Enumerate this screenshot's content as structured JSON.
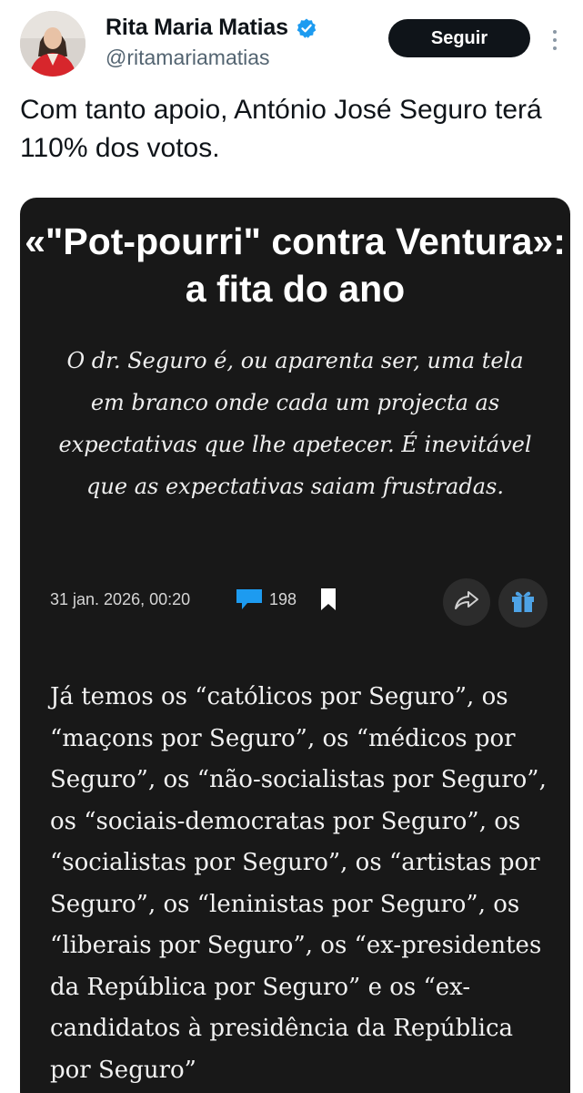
{
  "tweet": {
    "author": {
      "display_name": "Rita Maria Matias",
      "handle": "@ritamariamatias",
      "verified_icon": "verified-badge-icon",
      "verified_color": "#1d9bf0"
    },
    "follow_label": "Seguir",
    "text": "Com tanto apoio, António José Seguro terá 110% dos votos."
  },
  "article": {
    "title": "«\"Pot-pourri\" contra Ventura»: a fita do ano",
    "lead": "O dr. Seguro é, ou aparenta ser, uma tela em branco onde cada um projecta as expectativas que lhe apetecer. É inevitável que as expectativas saiam frustradas.",
    "date": "31 jan. 2026, 00:20",
    "comment_count": "198",
    "body": "Já temos os “católicos por Seguro”, os “maçons por Seguro”, os “médicos por Seguro”, os “não-socialistas por Seguro”, os “sociais-democratas por Seguro”, os “socialistas por Seguro”, os “artistas por Seguro”, os “leninistas por Seguro”, os “liberais por Seguro”, os “ex-presidentes da República por Seguro” e os “ex-candidatos à presidência da República por Seguro”",
    "colors": {
      "card_background": "#181818",
      "comment_icon": "#1d9bf0",
      "gift_icon": "#4ea3e6"
    }
  }
}
